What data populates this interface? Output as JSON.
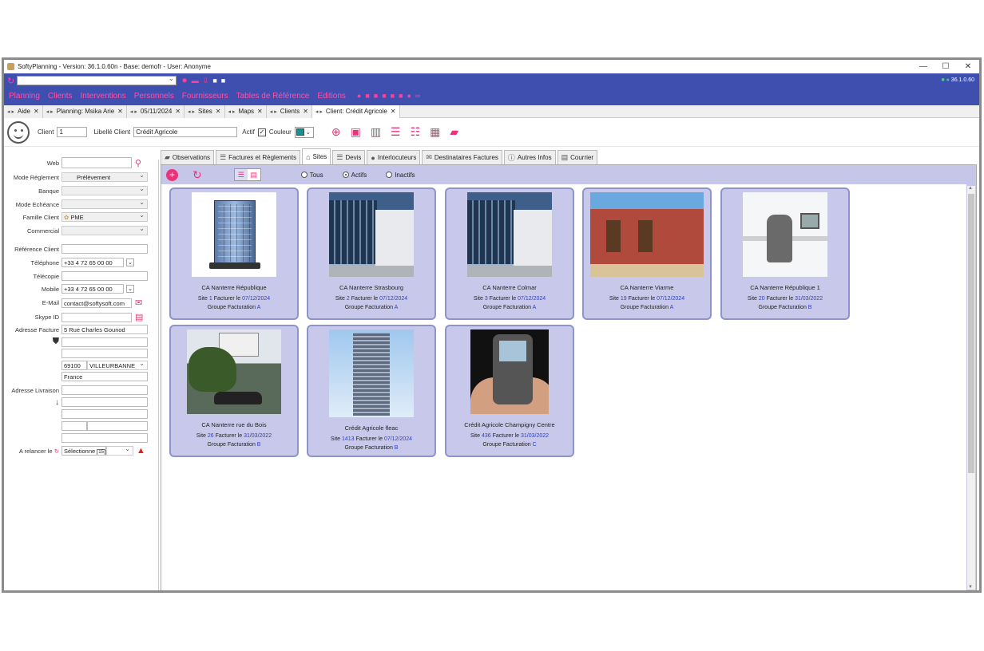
{
  "window": {
    "title": "SoftyPlanning - Version: 36.1.0.60n - Base: demofr - User: Anonyme",
    "controls": [
      "—",
      "☐",
      "✕"
    ]
  },
  "toolbar": {
    "version": "36.1.0.60"
  },
  "menu": [
    "Planning",
    "Clients",
    "Interventions",
    "Personnels",
    "Fournisseurs",
    "Tables de Référence",
    "Editions"
  ],
  "doc_tabs": [
    {
      "label": "Aide"
    },
    {
      "label": "Planning: Msika Arie"
    },
    {
      "label": "05/11/2024"
    },
    {
      "label": "Sites"
    },
    {
      "label": "Maps"
    },
    {
      "label": "Clients"
    },
    {
      "label": "Client: Crédit Agricole"
    }
  ],
  "client_header": {
    "client_label": "Client",
    "client_value": "1",
    "libelle_label": "Libellé Client",
    "libelle_value": "Crédit Agricole",
    "actif_label": "Actif",
    "actif_check": "✓",
    "couleur_label": "Couleur"
  },
  "form": {
    "web_label": "Web",
    "mode_reglement_label": "Mode Règlement",
    "mode_reglement_value": "Prélèvement",
    "banque_label": "Banque",
    "mode_echeance_label": "Mode Echéance",
    "famille_label": "Famille Client",
    "famille_value": "PME",
    "commercial_label": "Commercial",
    "reference_label": "Référence Client",
    "telephone_label": "Téléphone",
    "telephone_value": "+33 4 72 65 00 00",
    "telecopie_label": "Télécopie",
    "mobile_label": "Mobile",
    "mobile_value": "+33 4 72 65 00 00",
    "email_label": "E-Mail",
    "email_value": "contact@softysoft.com",
    "skype_label": "Skype ID",
    "adresse_facture_label": "Adresse Facture",
    "adresse_facture_value": "5 Rue Charles Gounod",
    "cp_value": "69100",
    "ville_value": "VILLEURBANNE",
    "pays_value": "France",
    "adresse_livraison_label": "Adresse Livraison",
    "relancer_label": "A relancer le",
    "relancer_value": "Sélectionne",
    "relancer_day": "15"
  },
  "sub_tabs": [
    "Observations",
    "Factures et Règlements",
    "Sites",
    "Devis",
    "Interlocuteurs",
    "Destinataires Factures",
    "Autres Infos",
    "Courrier"
  ],
  "filters": {
    "tous": "Tous",
    "actifs": "Actifs",
    "inactifs": "Inactifs"
  },
  "sites": [
    {
      "name": "CA Nanterre République",
      "site_prefix": "Site",
      "site_no": "1",
      "factur_label": "Facturer le",
      "date": "07/12/2024",
      "groupe_label": "Groupe Facturation",
      "groupe": "A"
    },
    {
      "name": "CA Nanterre Strasbourg",
      "site_prefix": "Site",
      "site_no": "2",
      "factur_label": "Facturer le",
      "date": "07/12/2024",
      "groupe_label": "Groupe Facturation",
      "groupe": "A"
    },
    {
      "name": "CA Nanterre Colmar",
      "site_prefix": "Site",
      "site_no": "3",
      "factur_label": "Facturer le",
      "date": "07/12/2024",
      "groupe_label": "Groupe Facturation",
      "groupe": "A"
    },
    {
      "name": "CA Nanterre Viarme",
      "site_prefix": "Site",
      "site_no": "19",
      "factur_label": "Facturer le",
      "date": "07/12/2024",
      "groupe_label": "Groupe Facturation",
      "groupe": "A"
    },
    {
      "name": "CA Nanterre République 1",
      "site_prefix": "Site",
      "site_no": "20",
      "factur_label": "Facturer le",
      "date": "31/03/2022",
      "groupe_label": "Groupe Facturation",
      "groupe": "B"
    },
    {
      "name": "CA Nanterre rue du Bois",
      "site_prefix": "Site",
      "site_no": "26",
      "factur_label": "Facturer le",
      "date": "31/03/2022",
      "groupe_label": "Groupe Facturation",
      "groupe": "B"
    },
    {
      "name": "Crédit Agricole fleac",
      "site_prefix": "Site",
      "site_no": "1413",
      "factur_label": "Facturer le",
      "date": "07/12/2024",
      "groupe_label": "Groupe Facturation",
      "groupe": "B"
    },
    {
      "name": "Crédit Agricole Champigny Centre",
      "site_prefix": "Site",
      "site_no": "436",
      "factur_label": "Facturer le",
      "date": "31/03/2022",
      "groupe_label": "Groupe Facturation",
      "groupe": "C"
    }
  ],
  "colors": {
    "brand_blue": "#3f4fb0",
    "accent_pink": "#e8357a",
    "card_bg": "#c8c9ea",
    "link_blue": "#2a3fcf"
  }
}
